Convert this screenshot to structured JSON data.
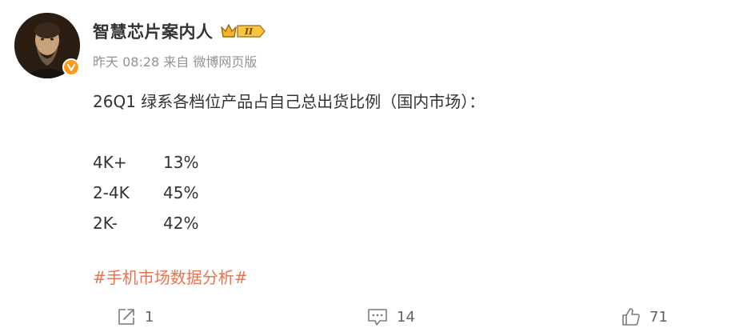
{
  "author": {
    "name": "智慧芯片案内人",
    "level_badge": "II",
    "avatar_icon": "portrait-avatar",
    "verified_color": "#ff9b1a"
  },
  "meta": {
    "time": "昨天 08:28",
    "source_prefix": "来自",
    "source": "微博网页版"
  },
  "post": {
    "heading": "26Q1 绿系各档位产品占自己总出货比例（国内市场）：",
    "shares": [
      {
        "tier": "4K+",
        "percent": "13%"
      },
      {
        "tier": "2-4K",
        "percent": "45%"
      },
      {
        "tier": "2K-",
        "percent": "42%"
      }
    ],
    "hashtag": "#手机市场数据分析#",
    "hashtag_color": "#eb7350"
  },
  "actions": {
    "share_count": "1",
    "comment_count": "14",
    "like_count": "71"
  }
}
